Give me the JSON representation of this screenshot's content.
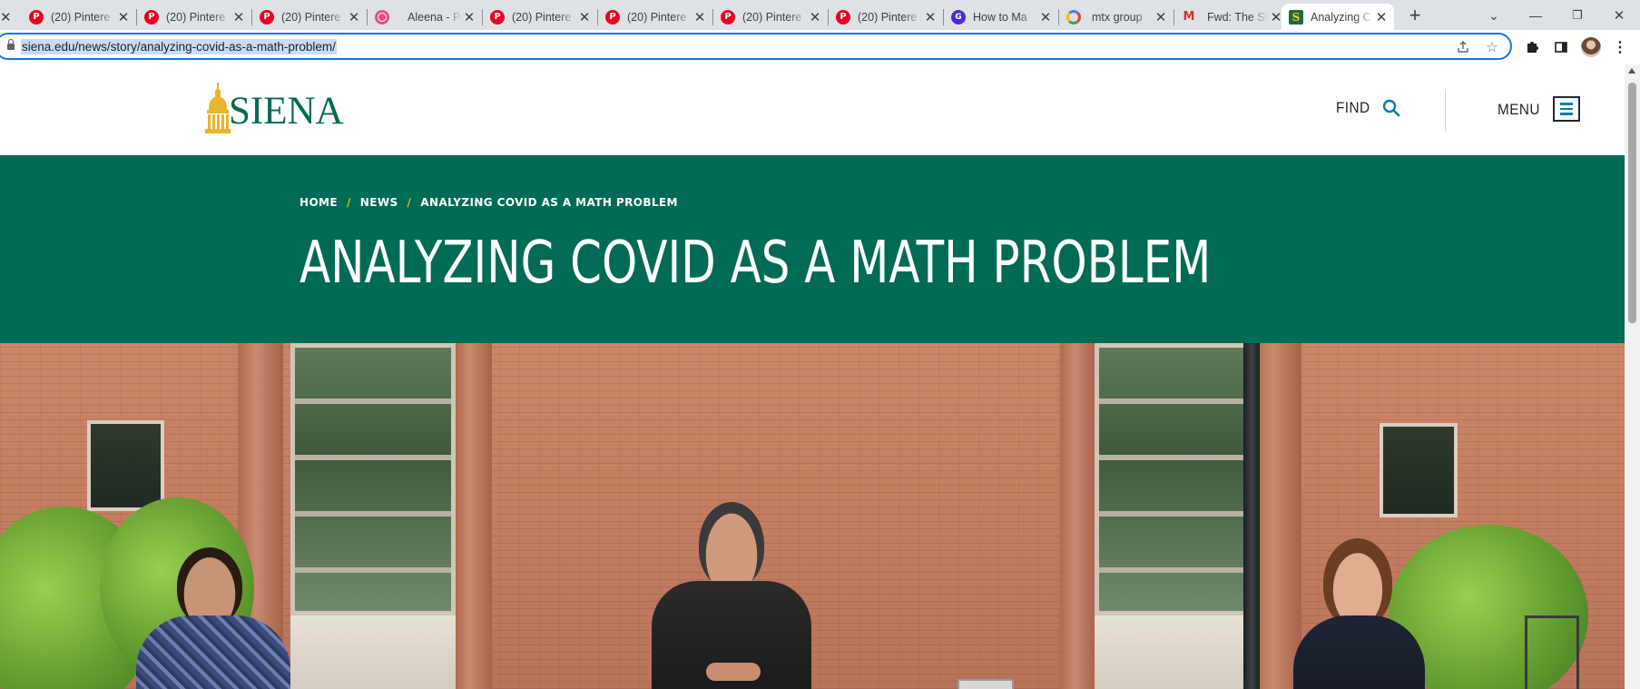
{
  "browser": {
    "tabs": [
      {
        "label": "(20) Pintere",
        "favicon": "pinterest-icon",
        "active": false
      },
      {
        "label": "(20) Pintere",
        "favicon": "pinterest-icon",
        "active": false
      },
      {
        "label": "(20) Pintere",
        "favicon": "pinterest-icon",
        "active": false
      },
      {
        "label": "Aleena - Pe",
        "favicon": "dribbble-icon",
        "active": false
      },
      {
        "label": "(20) Pintere",
        "favicon": "pinterest-icon",
        "active": false
      },
      {
        "label": "(20) Pintere",
        "favicon": "pinterest-icon",
        "active": false
      },
      {
        "label": "(20) Pintere",
        "favicon": "pinterest-icon",
        "active": false
      },
      {
        "label": "(20) Pintere",
        "favicon": "pinterest-icon",
        "active": false
      },
      {
        "label": "How to Ma",
        "favicon": "gp-icon",
        "active": false
      },
      {
        "label": "mtx group",
        "favicon": "google-icon",
        "active": false
      },
      {
        "label": "Fwd: The SC",
        "favicon": "gmail-icon",
        "active": false
      },
      {
        "label": "Analyzing C",
        "favicon": "siena-icon",
        "active": true
      }
    ],
    "new_tab_symbol": "+",
    "url": "siena.edu/news/story/analyzing-covid-as-a-math-problem/"
  },
  "site": {
    "logo_text": "SIENA",
    "find_label": "FIND",
    "menu_label": "MENU"
  },
  "hero": {
    "breadcrumb": [
      "HOME",
      "NEWS",
      "ANALYZING COVID AS A MATH PROBLEM"
    ],
    "breadcrumb_separator": "/",
    "title": "ANALYZING COVID AS A MATH PROBLEM"
  },
  "colors": {
    "brand_green": "#006b54",
    "breadcrumb_separator": "#f2b705",
    "logo_gold": "#f3c431",
    "link_blue": "#0a7fa3"
  }
}
